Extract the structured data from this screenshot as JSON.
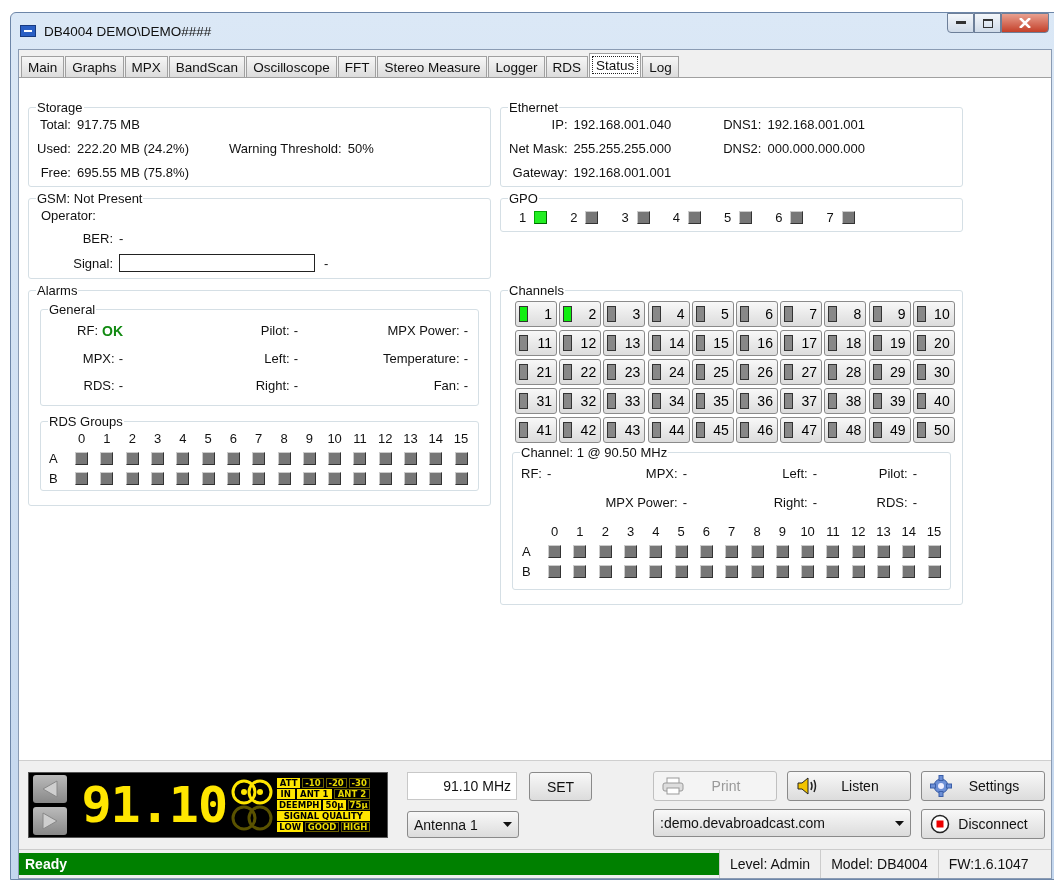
{
  "window": {
    "title": "DB4004 DEMO\\DEMO####"
  },
  "tabs": [
    {
      "label": "Main",
      "selected": false
    },
    {
      "label": "Graphs",
      "selected": false
    },
    {
      "label": "MPX",
      "selected": false
    },
    {
      "label": "BandScan",
      "selected": false
    },
    {
      "label": "Oscilloscope",
      "selected": false
    },
    {
      "label": "FFT",
      "selected": false
    },
    {
      "label": "Stereo Measure",
      "selected": false
    },
    {
      "label": "Logger",
      "selected": false
    },
    {
      "label": "RDS",
      "selected": false
    },
    {
      "label": "Status",
      "selected": true
    },
    {
      "label": "Log",
      "selected": false
    }
  ],
  "storage": {
    "title": "Storage",
    "rows": [
      {
        "label": "Total:",
        "value": "917.75 MB"
      },
      {
        "label": "Used:",
        "value": "222.20 MB (24.2%)"
      },
      {
        "label": "Free:",
        "value": "695.55 MB (75.8%)"
      }
    ],
    "warning": {
      "label": "Warning Threshold:",
      "value": "50%"
    }
  },
  "ethernet": {
    "title": "Ethernet",
    "left": [
      {
        "label": "IP:",
        "value": "192.168.001.040"
      },
      {
        "label": "Net Mask:",
        "value": "255.255.255.000"
      },
      {
        "label": "Gateway:",
        "value": "192.168.001.001"
      }
    ],
    "right": [
      {
        "label": "DNS1:",
        "value": "192.168.001.001"
      },
      {
        "label": "DNS2:",
        "value": "000.000.000.000"
      }
    ]
  },
  "gsm": {
    "title": "GSM: Not Present",
    "operator": "Operator:",
    "ber": {
      "label": "BER:",
      "value": "-"
    },
    "signal": {
      "label": "Signal:",
      "level": 0,
      "reading": "-"
    }
  },
  "gpo": {
    "title": "GPO",
    "items": [
      {
        "label": "1",
        "on": true
      },
      {
        "label": "2",
        "on": false
      },
      {
        "label": "3",
        "on": false
      },
      {
        "label": "4",
        "on": false
      },
      {
        "label": "5",
        "on": false
      },
      {
        "label": "6",
        "on": false
      },
      {
        "label": "7",
        "on": false
      }
    ]
  },
  "alarms": {
    "title": "Alarms",
    "general": {
      "title": "General",
      "rows": [
        {
          "items": [
            {
              "label": "RF:",
              "value": "OK",
              "ok": true
            },
            {
              "label": "Pilot:",
              "value": "-",
              "ok": false
            },
            {
              "label": "MPX Power:",
              "value": "-",
              "ok": false
            }
          ]
        },
        {
          "items": [
            {
              "label": "MPX:",
              "value": "-",
              "ok": false
            },
            {
              "label": "Left:",
              "value": "-",
              "ok": false
            },
            {
              "label": "Temperature:",
              "value": "-",
              "ok": false
            }
          ]
        },
        {
          "items": [
            {
              "label": "RDS:",
              "value": "-",
              "ok": false
            },
            {
              "label": "Right:",
              "value": "-",
              "ok": false
            },
            {
              "label": "Fan:",
              "value": "-",
              "ok": false
            }
          ]
        }
      ]
    },
    "rds_groups": {
      "title": "RDS Groups",
      "columns": [
        "0",
        "1",
        "2",
        "3",
        "4",
        "5",
        "6",
        "7",
        "8",
        "9",
        "10",
        "11",
        "12",
        "13",
        "14",
        "15"
      ],
      "rows": [
        {
          "label": "A",
          "leds": [
            false,
            false,
            false,
            false,
            false,
            false,
            false,
            false,
            false,
            false,
            false,
            false,
            false,
            false,
            false,
            false
          ]
        },
        {
          "label": "B",
          "leds": [
            false,
            false,
            false,
            false,
            false,
            false,
            false,
            false,
            false,
            false,
            false,
            false,
            false,
            false,
            false,
            false
          ]
        }
      ]
    }
  },
  "channels": {
    "title": "Channels",
    "buttons": [
      {
        "label": "1",
        "on": true
      },
      {
        "label": "2",
        "on": true
      },
      {
        "label": "3",
        "on": false
      },
      {
        "label": "4",
        "on": false
      },
      {
        "label": "5",
        "on": false
      },
      {
        "label": "6",
        "on": false
      },
      {
        "label": "7",
        "on": false
      },
      {
        "label": "8",
        "on": false
      },
      {
        "label": "9",
        "on": false
      },
      {
        "label": "10",
        "on": false
      },
      {
        "label": "11",
        "on": false
      },
      {
        "label": "12",
        "on": false
      },
      {
        "label": "13",
        "on": false
      },
      {
        "label": "14",
        "on": false
      },
      {
        "label": "15",
        "on": false
      },
      {
        "label": "16",
        "on": false
      },
      {
        "label": "17",
        "on": false
      },
      {
        "label": "18",
        "on": false
      },
      {
        "label": "19",
        "on": false
      },
      {
        "label": "20",
        "on": false
      },
      {
        "label": "21",
        "on": false
      },
      {
        "label": "22",
        "on": false
      },
      {
        "label": "23",
        "on": false
      },
      {
        "label": "24",
        "on": false
      },
      {
        "label": "25",
        "on": false
      },
      {
        "label": "26",
        "on": false
      },
      {
        "label": "27",
        "on": false
      },
      {
        "label": "28",
        "on": false
      },
      {
        "label": "29",
        "on": false
      },
      {
        "label": "30",
        "on": false
      },
      {
        "label": "31",
        "on": false
      },
      {
        "label": "32",
        "on": false
      },
      {
        "label": "33",
        "on": false
      },
      {
        "label": "34",
        "on": false
      },
      {
        "label": "35",
        "on": false
      },
      {
        "label": "36",
        "on": false
      },
      {
        "label": "37",
        "on": false
      },
      {
        "label": "38",
        "on": false
      },
      {
        "label": "39",
        "on": false
      },
      {
        "label": "40",
        "on": false
      },
      {
        "label": "41",
        "on": false
      },
      {
        "label": "42",
        "on": false
      },
      {
        "label": "43",
        "on": false
      },
      {
        "label": "44",
        "on": false
      },
      {
        "label": "45",
        "on": false
      },
      {
        "label": "46",
        "on": false
      },
      {
        "label": "47",
        "on": false
      },
      {
        "label": "48",
        "on": false
      },
      {
        "label": "49",
        "on": false
      },
      {
        "label": "50",
        "on": false
      }
    ],
    "detail": {
      "title": "Channel: 1 @ 90.50 MHz",
      "rows": [
        {
          "items": [
            {
              "label": "RF:",
              "value": "-"
            },
            {
              "label": "MPX:",
              "value": "-"
            },
            {
              "label": "Left:",
              "value": "-"
            },
            {
              "label": "Pilot:",
              "value": "-"
            }
          ]
        },
        {
          "items": [
            {
              "label": "MPX Power:",
              "value": "-"
            },
            {
              "label": "Right:",
              "value": "-"
            },
            {
              "label": "RDS:",
              "value": "-"
            }
          ]
        }
      ],
      "rds_groups": {
        "columns": [
          "0",
          "1",
          "2",
          "3",
          "4",
          "5",
          "6",
          "7",
          "8",
          "9",
          "10",
          "11",
          "12",
          "13",
          "14",
          "15"
        ],
        "rows": [
          {
            "label": "A",
            "leds": [
              false,
              false,
              false,
              false,
              false,
              false,
              false,
              false,
              false,
              false,
              false,
              false,
              false,
              false,
              false,
              false
            ]
          },
          {
            "label": "B",
            "leds": [
              false,
              false,
              false,
              false,
              false,
              false,
              false,
              false,
              false,
              false,
              false,
              false,
              false,
              false,
              false,
              false
            ]
          }
        ]
      }
    }
  },
  "lcd": {
    "display": "91.10",
    "indicators": [
      {
        "cells": [
          {
            "label": "ATT",
            "on": true
          },
          {
            "label": "-10",
            "on": false
          },
          {
            "label": "-20",
            "on": false
          },
          {
            "label": "-30",
            "on": false
          }
        ]
      },
      {
        "cells": [
          {
            "label": "IN",
            "on": true
          },
          {
            "label": "ANT 1",
            "on": true
          },
          {
            "label": "ANT 2",
            "on": false
          }
        ]
      },
      {
        "cells": [
          {
            "label": "DEEMPH",
            "on": true
          },
          {
            "label": "50μ",
            "on": true
          },
          {
            "label": "75μ",
            "on": false
          }
        ]
      },
      {
        "cells": [
          {
            "label": "SIGNAL QUALITY",
            "on": true
          }
        ]
      },
      {
        "cells": [
          {
            "label": "LOW",
            "on": true
          },
          {
            "label": "GOOD",
            "on": false
          },
          {
            "label": "HIGH",
            "on": false
          }
        ]
      }
    ]
  },
  "controls": {
    "frequency": "91.10 MHz",
    "set": "SET",
    "antenna": "Antenna 1",
    "print": {
      "label": "Print",
      "disabled": true
    },
    "listen": "Listen",
    "settings": "Settings",
    "host": ":demo.devabroadcast.com",
    "disconnect": "Disconnect"
  },
  "status_bar": {
    "message": "Ready",
    "level": "Level: Admin",
    "model": "Model: DB4004",
    "firmware": "FW:1.6.1047"
  }
}
